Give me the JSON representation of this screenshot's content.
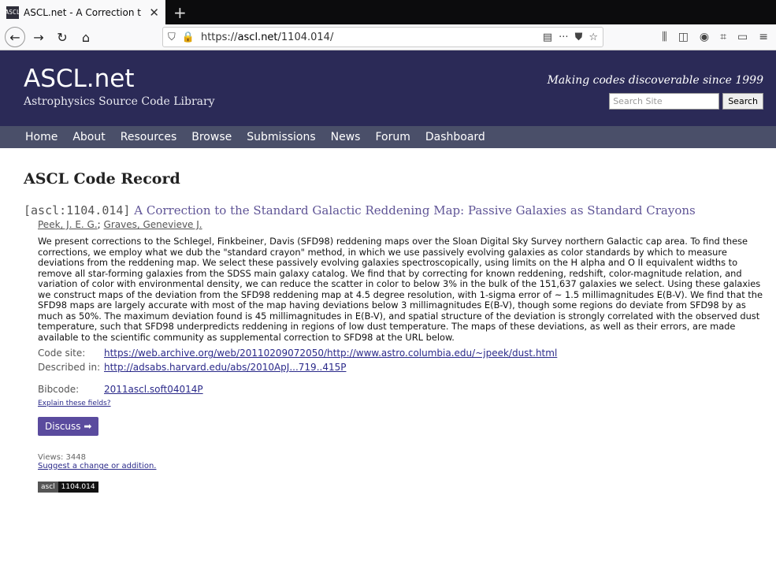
{
  "browser": {
    "tab_title": "ASCL.net - A Correction t",
    "favicon_label": "ASCL",
    "url_prefix": "https://",
    "url_host": "ascl.net",
    "url_path": "/1104.014/"
  },
  "site": {
    "logo": "ASCL.net",
    "logo_sub": "Astrophysics Source Code Library",
    "tagline": "Making codes discoverable since 1999",
    "search_placeholder": "Search Site",
    "search_button": "Search"
  },
  "nav": {
    "items": [
      "Home",
      "About",
      "Resources",
      "Browse",
      "Submissions",
      "News",
      "Forum",
      "Dashboard"
    ]
  },
  "page": {
    "heading": "ASCL Code Record",
    "record_id": "[ascl:1104.014]",
    "record_title": "A Correction to the Standard Galactic Reddening Map: Passive Galaxies as Standard Crayons",
    "authors": [
      "Peek, J. E. G.",
      "Graves, Genevieve J."
    ],
    "abstract": "We present corrections to the Schlegel, Finkbeiner, Davis (SFD98) reddening maps over the Sloan Digital Sky Survey northern Galactic cap area. To find these corrections, we employ what we dub the \"standard crayon\" method, in which we use passively evolving galaxies as color standards by which to measure deviations from the reddening map. We select these passively evolving galaxies spectroscopically, using limits on the H alpha and O II equivalent widths to remove all star-forming galaxies from the SDSS main galaxy catalog. We find that by correcting for known reddening, redshift, color-magnitude relation, and variation of color with environmental density, we can reduce the scatter in color to below 3% in the bulk of the 151,637 galaxies we select. Using these galaxies we construct maps of the deviation from the SFD98 reddening map at 4.5 degree resolution, with 1-sigma error of ~ 1.5 millimagnitudes E(B-V). We find that the SFD98 maps are largely accurate with most of the map having deviations below 3 millimagnitudes E(B-V), though some regions do deviate from SFD98 by as much as 50%. The maximum deviation found is 45 millimagnitudes in E(B-V), and spatial structure of the deviation is strongly correlated with the observed dust temperature, such that SFD98 underpredicts reddening in regions of low dust temperature. The maps of these deviations, as well as their errors, are made available to the scientific community as supplemental correction to SFD98 at the URL below.",
    "code_site_label": "Code site:",
    "code_site_url": "https://web.archive.org/web/20110209072050/http://www.astro.columbia.edu/~jpeek/dust.html",
    "described_label": "Described in:",
    "described_url": "http://adsabs.harvard.edu/abs/2010ApJ...719..415P",
    "bibcode_label": "Bibcode:",
    "bibcode": "2011ascl.soft04014P",
    "explain": "Explain these fields?",
    "discuss": "Discuss ➡",
    "views": "Views: 3448",
    "suggest": "Suggest a change or addition.",
    "badge_left": "ascl",
    "badge_right": "1104.014"
  }
}
